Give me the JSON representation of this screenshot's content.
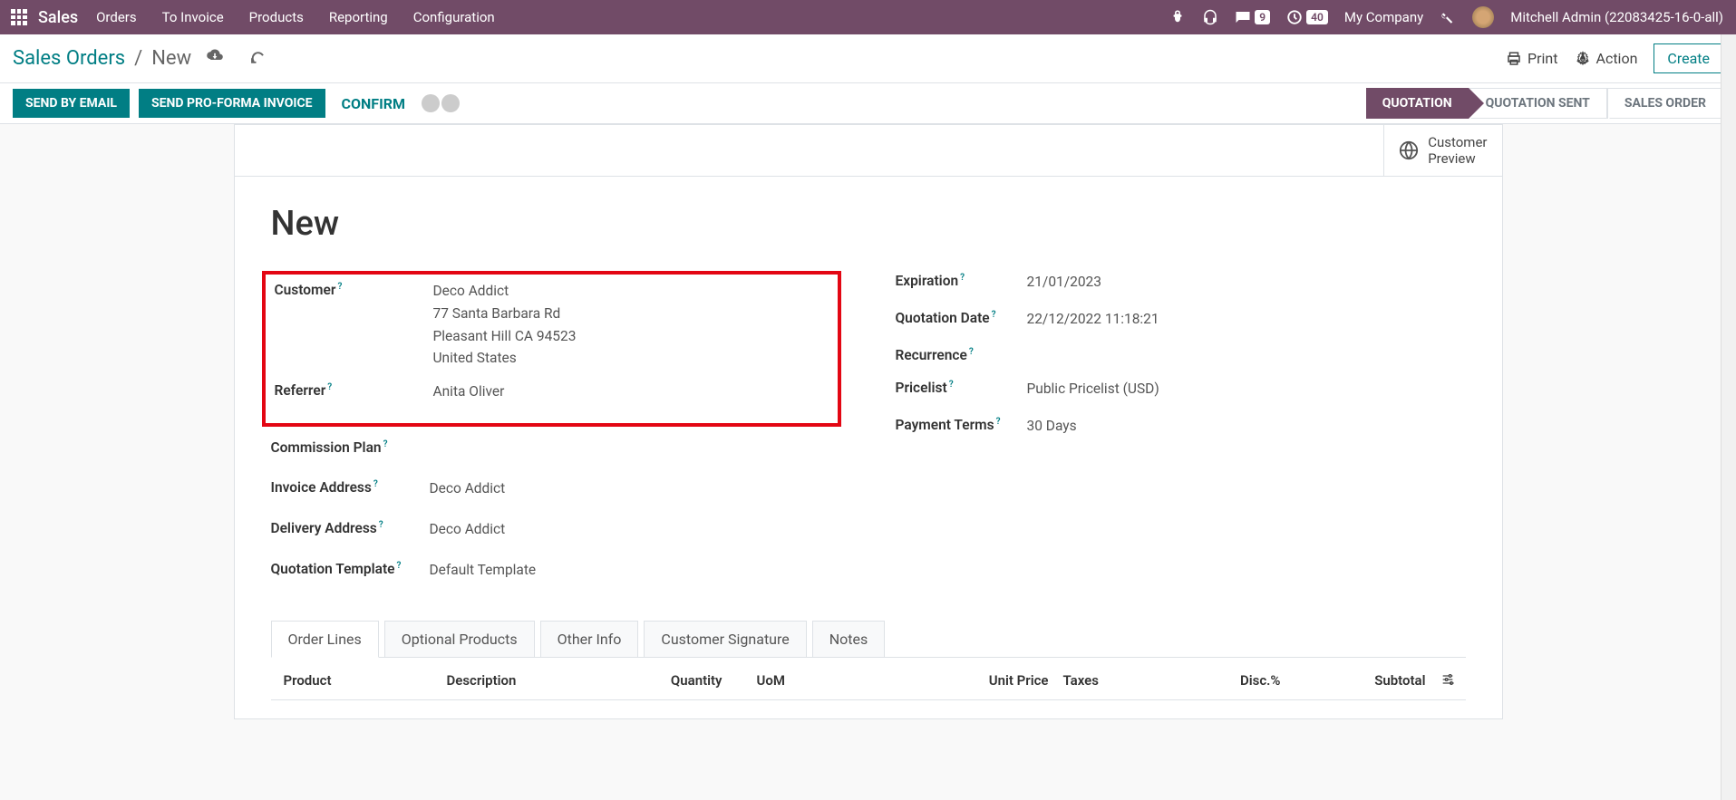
{
  "navbar": {
    "brand": "Sales",
    "menu": [
      "Orders",
      "To Invoice",
      "Products",
      "Reporting",
      "Configuration"
    ],
    "msg_badge": "9",
    "activity_badge": "40",
    "company": "My Company",
    "user": "Mitchell Admin (22083425-16-0-all)"
  },
  "breadcrumb": {
    "root": "Sales Orders",
    "current": "New"
  },
  "control_actions": {
    "print": "Print",
    "action": "Action",
    "create": "Create"
  },
  "status_buttons": {
    "send_email": "SEND BY EMAIL",
    "send_proforma": "SEND PRO-FORMA INVOICE",
    "confirm": "CONFIRM"
  },
  "status_steps": [
    "QUOTATION",
    "QUOTATION SENT",
    "SALES ORDER"
  ],
  "customer_preview": {
    "line1": "Customer",
    "line2": "Preview"
  },
  "form": {
    "title": "New",
    "left": {
      "customer_label": "Customer",
      "customer_name": "Deco Addict",
      "customer_addr1": "77 Santa Barbara Rd",
      "customer_addr2": "Pleasant Hill CA 94523",
      "customer_addr3": "United States",
      "referrer_label": "Referrer",
      "referrer_value": "Anita Oliver",
      "commission_label": "Commission Plan",
      "invoice_addr_label": "Invoice Address",
      "invoice_addr_value": "Deco Addict",
      "delivery_addr_label": "Delivery Address",
      "delivery_addr_value": "Deco Addict",
      "quote_tmpl_label": "Quotation Template",
      "quote_tmpl_value": "Default Template"
    },
    "right": {
      "expiration_label": "Expiration",
      "expiration_value": "21/01/2023",
      "quote_date_label": "Quotation Date",
      "quote_date_value": "22/12/2022 11:18:21",
      "recurrence_label": "Recurrence",
      "pricelist_label": "Pricelist",
      "pricelist_value": "Public Pricelist (USD)",
      "payment_terms_label": "Payment Terms",
      "payment_terms_value": "30 Days"
    }
  },
  "tabs": [
    "Order Lines",
    "Optional Products",
    "Other Info",
    "Customer Signature",
    "Notes"
  ],
  "table_headers": {
    "product": "Product",
    "description": "Description",
    "quantity": "Quantity",
    "uom": "UoM",
    "unit_price": "Unit Price",
    "taxes": "Taxes",
    "disc": "Disc.%",
    "subtotal": "Subtotal"
  }
}
